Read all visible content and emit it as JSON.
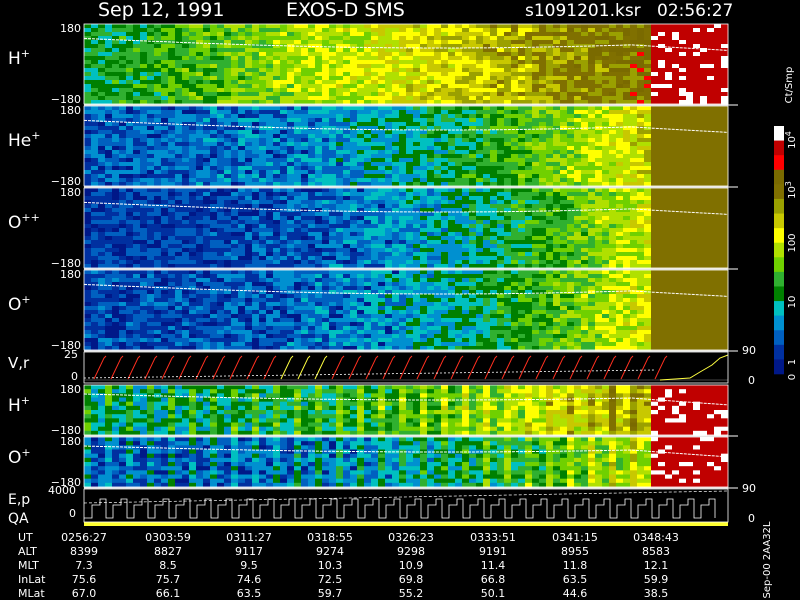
{
  "header": {
    "date": "Sep 12, 1991",
    "instrument": "EXOS-D SMS",
    "file": "s1091201.ksr",
    "time": "02:56:27"
  },
  "panels": [
    {
      "label": "H",
      "sup": "+",
      "top_tick": "180",
      "bottom_tick": "−180",
      "level": 0.35
    },
    {
      "label": "He",
      "sup": "+",
      "top_tick": "180",
      "bottom_tick": "−180",
      "level": 0.12
    },
    {
      "label": "O",
      "sup": "++",
      "top_tick": "180",
      "bottom_tick": "−180",
      "level": 0.06
    },
    {
      "label": "O",
      "sup": "+",
      "top_tick": "180",
      "bottom_tick": "−180",
      "level": 0.08
    },
    {
      "label": "H",
      "sup": "+",
      "top_tick": "180",
      "bottom_tick": "−180",
      "level": 0.25
    },
    {
      "label": "O",
      "sup": "+",
      "top_tick": "180",
      "bottom_tick": "−180",
      "level": 0.1
    }
  ],
  "vr_panel": {
    "label": "V,r",
    "top_tick": "25",
    "zero_tick": "0",
    "right_top": "90",
    "right_bottom": "0"
  },
  "ep_panel": {
    "label": "E,p",
    "label2": "QA",
    "top_tick": "4000",
    "zero_tick": "0",
    "right_top": "90",
    "right_bottom": "0"
  },
  "colorbar": {
    "unit": "Ct/Smp",
    "ticks": [
      {
        "label": "10",
        "sup": "4"
      },
      {
        "label": "10",
        "sup": "3"
      },
      {
        "label": "100",
        "sup": ""
      },
      {
        "label": "10",
        "sup": ""
      },
      {
        "label": "1",
        "sup": ""
      },
      {
        "label": "0",
        "sup": ""
      }
    ],
    "colors": [
      "#ffffff",
      "#c00000",
      "#ff0000",
      "#7a6a00",
      "#807000",
      "#9aa000",
      "#c8c800",
      "#ffff00",
      "#b0e000",
      "#70d000",
      "#30b030",
      "#008000",
      "#00c0c0",
      "#0090d0",
      "#0060c0",
      "#0030a0",
      "#001888"
    ]
  },
  "footer": {
    "row_labels": [
      "UT",
      "ALT",
      "MLT",
      "InLat",
      "MLat"
    ],
    "columns": [
      [
        "0256:27",
        "8399",
        "7.3",
        "75.6",
        "67.0"
      ],
      [
        "0303:59",
        "8827",
        "8.5",
        "75.7",
        "66.1"
      ],
      [
        "0311:27",
        "9117",
        "9.5",
        "74.6",
        "63.5"
      ],
      [
        "0318:55",
        "9274",
        "10.3",
        "72.5",
        "59.7"
      ],
      [
        "0326:23",
        "9298",
        "10.9",
        "69.8",
        "55.2"
      ],
      [
        "0333:51",
        "9191",
        "11.4",
        "66.8",
        "50.1"
      ],
      [
        "0341:15",
        "8955",
        "11.8",
        "63.5",
        "44.6"
      ],
      [
        "0348:43",
        "8583",
        "12.1",
        "59.9",
        "38.5"
      ]
    ],
    "stamp": "Sep-00  2AA32L"
  }
}
